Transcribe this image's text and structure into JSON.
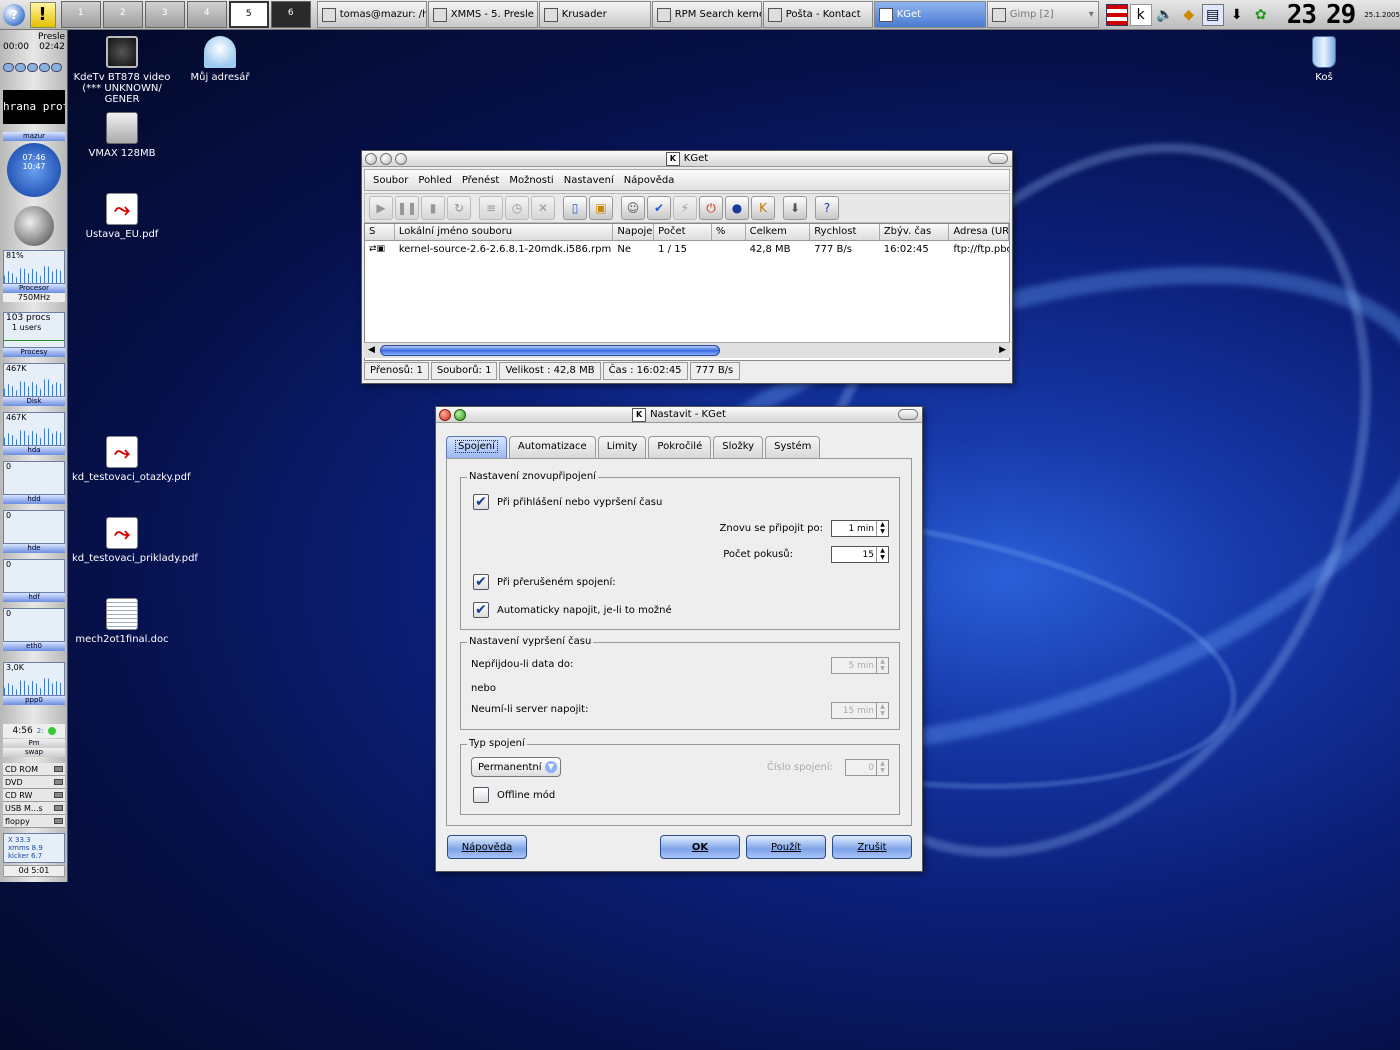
{
  "panel": {
    "desktops": [
      "1",
      "2",
      "3",
      "4",
      "5",
      "6"
    ],
    "active_desktop": "5",
    "tasks": [
      {
        "label": "tomas@mazur: /ho"
      },
      {
        "label": "XMMS - 5. Presle"
      },
      {
        "label": "Krusader"
      },
      {
        "label": "RPM Search kerne"
      },
      {
        "label": "Pošta - Kontact"
      },
      {
        "label": "KGet"
      },
      {
        "label": "Gimp [2]"
      }
    ],
    "clock_hours": "23",
    "clock_minutes": "29",
    "date": "25.1.2005"
  },
  "gkrellm": {
    "song": "Presle",
    "time_elapsed": "00:00",
    "time_total": "02:42",
    "scroll_text": "hrana proti",
    "host": "mazur",
    "clock": "10:47",
    "clock2": "07:46",
    "cpu_percent": "81%",
    "cpu_label": "Procesor",
    "cpu_freq": "750MHz",
    "procs": "103 procs",
    "users": "1 users",
    "procs_label": "Procesy",
    "disk_rate": "467K",
    "disk_label": "Disk",
    "disk_rate2": "467K",
    "hda_label": "hda",
    "hda_val": "0",
    "hdd_label": "hdd",
    "hdd_val": "0",
    "hde_label": "hde",
    "hde_val": "0",
    "hdf_label": "hdf",
    "hdf_val": "0",
    "eth_label": "eth0",
    "eth_rate": "3,0K",
    "ppp_label": "ppp0",
    "ppp_time": "4:56",
    "ppp_sub": "2:",
    "pm_label": "Pm",
    "swap_label": "swap",
    "drives": [
      "CD ROM",
      "DVD",
      "CD RW",
      "USB M...s",
      "floppy"
    ],
    "stats": [
      "X 33.3",
      "xmms 8.9",
      "kicker 6.7"
    ],
    "uptime": "0d 5:01"
  },
  "desktop_icons": [
    {
      "label": "KdeTv BT878 video (*** UNKNOWN/ GENER",
      "icon": "tv-icon"
    },
    {
      "label": "Můj adresář",
      "icon": "home-folder-icon"
    },
    {
      "label": "VMAX 128MB",
      "icon": "disk-icon"
    },
    {
      "label": "Ustava_EU.pdf",
      "icon": "pdf-icon"
    },
    {
      "label": "kd_testovaci_otazky.pdf",
      "icon": "pdf-icon"
    },
    {
      "label": "kd_testovaci_priklady.pdf",
      "icon": "pdf-icon"
    },
    {
      "label": "mech2ot1final.doc",
      "icon": "doc-icon"
    },
    {
      "label": "Koš",
      "icon": "trash-icon"
    }
  ],
  "kget": {
    "title": "KGet",
    "menu": [
      "Soubor",
      "Pohled",
      "Přenést",
      "Možnosti",
      "Nastavení",
      "Nápověda"
    ],
    "columns": [
      "S",
      "Lokální jméno souboru",
      "Napoje",
      "Počet",
      "%",
      "Celkem",
      "Rychlost",
      "Zbýv. čas",
      "Adresa (UR"
    ],
    "rows": [
      {
        "s": "",
        "file": "kernel-source-2.6-2.6.8.1-20mdk.i586.rpm",
        "resume": "Ne",
        "count": "1 / 15",
        "percent": "",
        "total": "42,8 MB",
        "speed": "777 B/s",
        "remaining": "16:02:45",
        "url": "ftp://ftp.pbone"
      }
    ],
    "status": [
      "Přenosů: 1",
      "Souborů: 1",
      "Velikost : 42,8 MB",
      "Čas : 16:02:45",
      "777 B/s"
    ]
  },
  "settings": {
    "title": "Nastavit - KGet",
    "tabs": [
      "Spojení",
      "Automatizace",
      "Limity",
      "Pokročilé",
      "Složky",
      "Systém"
    ],
    "reconnect_group": "Nastavení znovupřipojení",
    "on_login_timeout": "Při přihlášení nebo vypršení času",
    "reconnect_after_label": "Znovu se připojit po:",
    "reconnect_after_value": "1 min",
    "tries_label": "Počet pokusů:",
    "tries_value": "15",
    "on_broken": "Při přerušeném spojení:",
    "auto_resume": "Automaticky napojit, je-li to možné",
    "timeout_group": "Nastavení vypršení času",
    "no_data_label": "Nepřijdou-li data do:",
    "no_data_value": "5 min",
    "or_label": "nebo",
    "no_resume_label": "Neumí-li server napojit:",
    "no_resume_value": "15 min",
    "conn_group": "Typ spojení",
    "conn_type": "Permanentní",
    "conn_number_label": "Číslo spojení:",
    "conn_number_value": "0",
    "offline_mode": "Offline mód",
    "help_button": "Nápověda",
    "ok_button": "OK",
    "apply_button": "Použít",
    "cancel_button": "Zrušit"
  }
}
